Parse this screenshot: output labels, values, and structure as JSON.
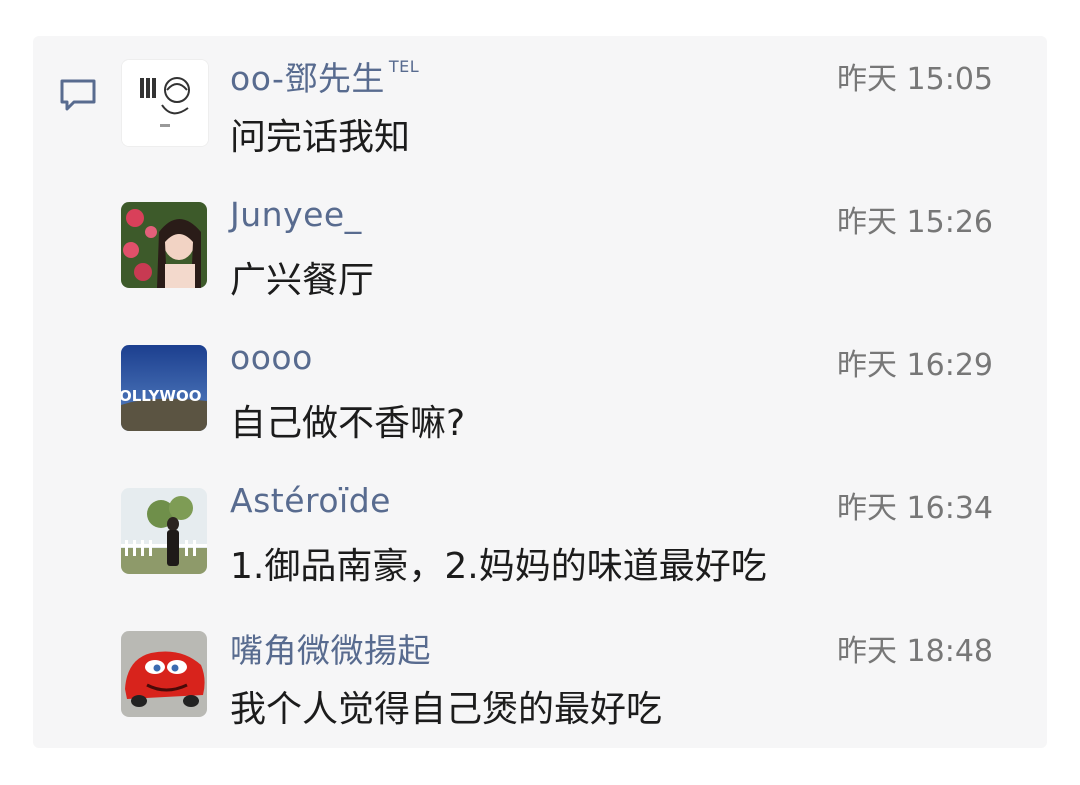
{
  "comments": [
    {
      "name": "oo-鄧先生",
      "badge": "TEL",
      "time": "昨天 15:05",
      "text": "问完话我知",
      "avatar": "sticker-avatar"
    },
    {
      "name": "Junyee_",
      "badge": "",
      "time": "昨天 15:26",
      "text": "广兴餐厅",
      "avatar": "rose-portrait-avatar"
    },
    {
      "name": "oooo",
      "badge": "",
      "time": "昨天 16:29",
      "text": "自己做不香嘛?",
      "avatar": "hollywood-sign-avatar",
      "avatar_text": "OLLYWOO"
    },
    {
      "name": "Astéroïde",
      "badge": "",
      "time": "昨天 16:34",
      "text": "1.御品南豪，2.妈妈的味道最好吃",
      "avatar": "outdoor-photo-avatar"
    },
    {
      "name": "嘴角微微揚起",
      "badge": "",
      "time": "昨天 18:48",
      "text": "我个人觉得自己煲的最好吃",
      "avatar": "red-car-avatar"
    }
  ],
  "icons": {
    "comment": "comment-icon"
  },
  "colors": {
    "name": "#586b8f",
    "time": "#777777",
    "text": "#1c1c1c",
    "panel": "#f6f6f7"
  }
}
